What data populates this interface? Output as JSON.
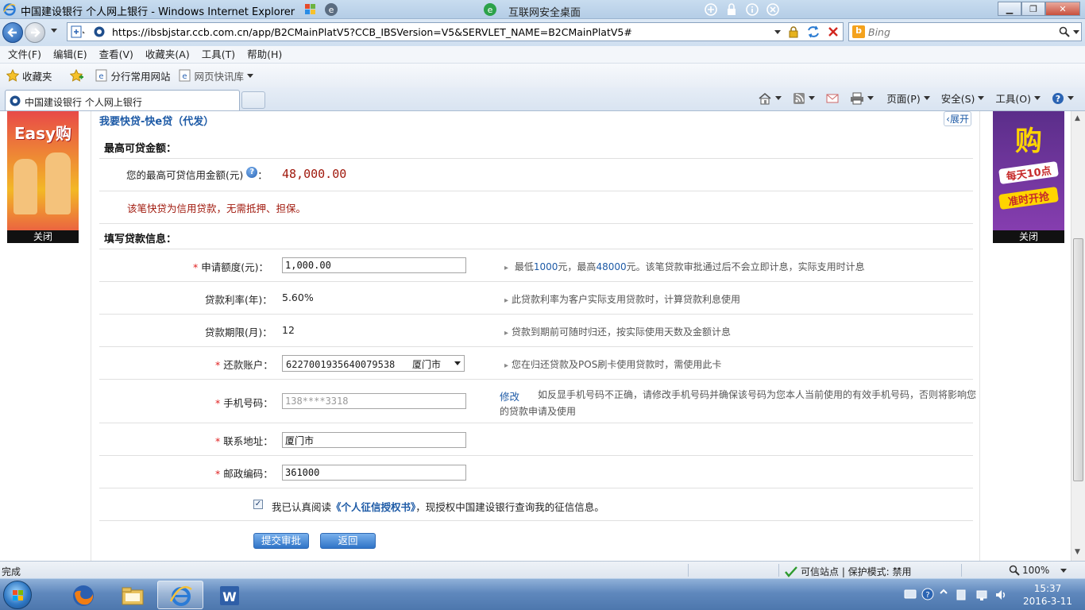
{
  "window": {
    "title": "中国建设银行 个人网上银行 - Windows Internet Explorer",
    "security_desktop": "互联网安全桌面"
  },
  "address": {
    "url": "https://ibsbjstar.ccb.com.cn/app/B2CMainPlatV5?CCB_IBSVersion=V5&SERVLET_NAME=B2CMainPlatV5#",
    "search_placeholder": "Bing"
  },
  "menu": [
    "文件(F)",
    "编辑(E)",
    "查看(V)",
    "收藏夹(A)",
    "工具(T)",
    "帮助(H)"
  ],
  "favorites": {
    "fav_label": "收藏夹",
    "items": [
      "分行常用网站",
      "网页快讯库"
    ]
  },
  "tab": {
    "label": "中国建设银行 个人网上银行"
  },
  "commandbar": {
    "page": "页面(P)",
    "safety": "安全(S)",
    "tools": "工具(O)"
  },
  "ads": {
    "left_text": "Easy购",
    "left_close": "关闭",
    "right_main": "购",
    "right_line1": "每天10点",
    "right_line2": "准时开抢",
    "right_close": "关闭"
  },
  "page": {
    "crumb": "我要快贷-快e贷（代发）",
    "expand": "展开",
    "max_section": "最高可贷金额：",
    "max_label": "您的最高可贷信用金额(元)",
    "max_colon": "：",
    "max_amount": "48,000.00",
    "credit_note": "该笔快贷为信用贷款，无需抵押、担保。",
    "fill_section": "填写贷款信息：",
    "rows": {
      "amount": {
        "required": "*",
        "label": "申请额度(元)：",
        "value": "1,000.00",
        "hint_pre": "最低",
        "hint_min": "1000",
        "hint_mid": "元，最高",
        "hint_max": "48000",
        "hint_post": "元。该笔贷款审批通过后不会立即计息，实际支用时计息"
      },
      "rate": {
        "label": "贷款利率(年)：",
        "value": "5.60%",
        "hint": "此贷款利率为客户实际支用贷款时，计算贷款利息使用"
      },
      "term": {
        "label": "贷款期限(月)：",
        "value": "12",
        "hint": "贷款到期前可随时归还，按实际使用天数及金额计息"
      },
      "account": {
        "required": "*",
        "label": "还款账户：",
        "value": "6227001935640079538",
        "city": "厦门市",
        "hint": "您在归还贷款及POS刷卡使用贷款时，需使用此卡"
      },
      "phone": {
        "required": "*",
        "label": "手机号码：",
        "value": "138****3318",
        "modify": "修改",
        "hint": "如反显手机号码不正确，请修改手机号码并确保该号码为您本人当前使用的有效手机号码，否则将影响您的贷款申请及使用"
      },
      "address": {
        "required": "*",
        "label": "联系地址：",
        "value": "厦门市"
      },
      "postcode": {
        "required": "*",
        "label": "邮政编码：",
        "value": "361000"
      }
    },
    "agree": {
      "checkmark": "✓",
      "pre": "我已认真阅读",
      "link": "《个人征信授权书》",
      "post": "，现授权中国建设银行查询我的征信信息。"
    },
    "submit": "提交审批",
    "back": "返回"
  },
  "status": {
    "left": "完成",
    "zone": "可信站点 | 保护模式: 禁用",
    "zoom": "100%"
  },
  "clock": {
    "time": "15:37",
    "date": "2016-3-11"
  }
}
